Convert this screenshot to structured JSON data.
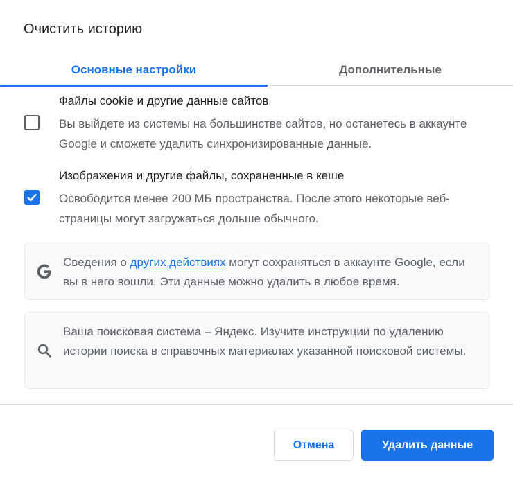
{
  "dialog": {
    "title": "Очистить историю"
  },
  "tabs": [
    {
      "label": "Основные настройки",
      "active": true
    },
    {
      "label": "Дополнительные",
      "active": false
    }
  ],
  "options": [
    {
      "title": "Файлы cookie и другие данные сайтов",
      "description": "Вы выйдете из системы на большинстве сайтов, но останетесь в аккаунте Google и сможете удалить синхронизированные данные.",
      "checked": false
    },
    {
      "title": "Изображения и другие файлы, сохраненные в кеше",
      "description": "Освободится менее 200 МБ пространства. После этого некоторые веб-страницы могут загружаться дольше обычного.",
      "checked": true
    }
  ],
  "info_google": {
    "icon": "google-g-icon",
    "text_before": "Сведения о ",
    "link": "других действиях",
    "text_after": " могут сохраняться в аккаунте Google, если вы в него вошли. Эти данные можно удалить в любое время."
  },
  "info_search": {
    "icon": "search-icon",
    "text": "Ваша поисковая система – Яндекс. Изучите инструкции по удалению истории поиска в справочных материалах указанной поисковой системы."
  },
  "buttons": {
    "cancel": "Отмена",
    "delete": "Удалить данные"
  },
  "colors": {
    "accent": "#1a73e8",
    "text_primary": "#202124",
    "text_secondary": "#5f6368",
    "info_bg": "#f8f9fa"
  }
}
